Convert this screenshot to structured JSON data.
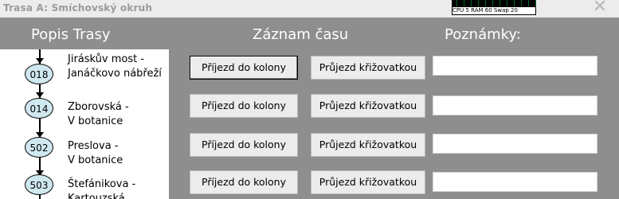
{
  "window": {
    "title": "Trasa A: Smíchovský okruh",
    "close_glyph": "✕"
  },
  "monitor": {
    "text": "CPU 5 RAM 60 Swap 20"
  },
  "headers": {
    "route": "Popis Trasy",
    "time": "Záznam času",
    "notes": "Poznámky:"
  },
  "stops": [
    {
      "code": "018",
      "name_line1": "Jiráskův most -",
      "name_line2": "Janáčkovo nábřeží"
    },
    {
      "code": "014",
      "name_line1": "Zborovská -",
      "name_line2": "V botanice"
    },
    {
      "code": "502",
      "name_line1": "Preslova -",
      "name_line2": "V botanice"
    },
    {
      "code": "503",
      "name_line1": "Štefánikova -",
      "name_line2": "Kartouzská"
    }
  ],
  "rows": [
    {
      "arrival_label": "Příjezd do kolony",
      "crossing_label": "Průjezd křižovatkou",
      "note_value": ""
    },
    {
      "arrival_label": "Příjezd do kolony",
      "crossing_label": "Průjezd křižovatkou",
      "note_value": ""
    },
    {
      "arrival_label": "Příjezd do kolony",
      "crossing_label": "Průjezd křižovatkou",
      "note_value": ""
    },
    {
      "arrival_label": "Příjezd do kolony",
      "crossing_label": "Průjezd křižovatkou",
      "note_value": ""
    }
  ],
  "colors": {
    "panel": "#8e8e8e",
    "button": "#ececec",
    "bubble": "#cfe8ef"
  }
}
